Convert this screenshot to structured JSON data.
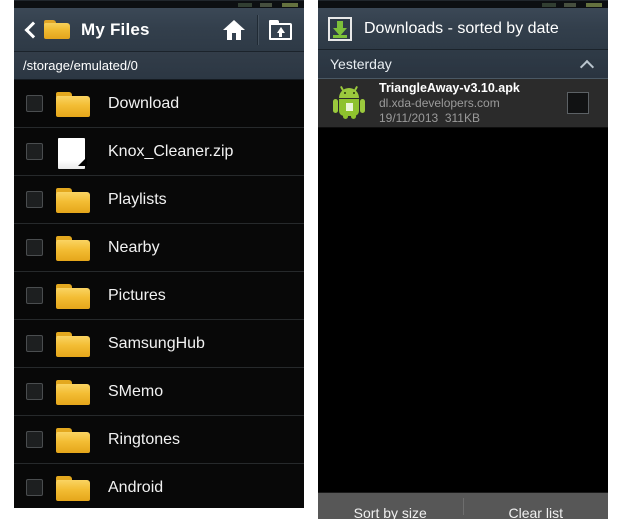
{
  "files_panel": {
    "titlebar": {
      "back_icon": "back-chevron-icon",
      "folder_icon": "folder-icon",
      "title": "My Files",
      "home_icon": "home-icon",
      "folder_up_icon": "folder-up-icon"
    },
    "path": "/storage/emulated/0",
    "items": [
      {
        "name": "Download",
        "icon": "folder-icon",
        "checked": false
      },
      {
        "name": "Knox_Cleaner.zip",
        "icon": "document-icon",
        "checked": false
      },
      {
        "name": "Playlists",
        "icon": "folder-icon",
        "checked": false
      },
      {
        "name": "Nearby",
        "icon": "folder-icon",
        "checked": false
      },
      {
        "name": "Pictures",
        "icon": "folder-icon",
        "checked": false
      },
      {
        "name": "SamsungHub",
        "icon": "folder-icon",
        "checked": false
      },
      {
        "name": "SMemo",
        "icon": "folder-icon",
        "checked": false
      },
      {
        "name": "Ringtones",
        "icon": "folder-icon",
        "checked": false
      },
      {
        "name": "Android",
        "icon": "folder-icon",
        "checked": false
      }
    ]
  },
  "downloads_panel": {
    "titlebar": {
      "download_icon": "download-icon",
      "title": "Downloads - sorted by date"
    },
    "section": {
      "label": "Yesterday",
      "collapse_icon": "chevron-up-icon"
    },
    "items": [
      {
        "icon": "android-apk-icon",
        "filename": "TriangleAway-v3.10.apk",
        "source": "dl.xda-developers.com",
        "date": "19/11/2013",
        "size": "311KB",
        "checked": false
      }
    ],
    "bottom_bar": {
      "sort_label": "Sort by size",
      "clear_label": "Clear list"
    }
  },
  "colors": {
    "titlebar": "#333f4c",
    "pathbar": "#2e3945",
    "list_background": "#080808",
    "folder_yellow": "#f3bd34",
    "download_green": "#7dc03a",
    "bottom_bar": "#575757"
  }
}
